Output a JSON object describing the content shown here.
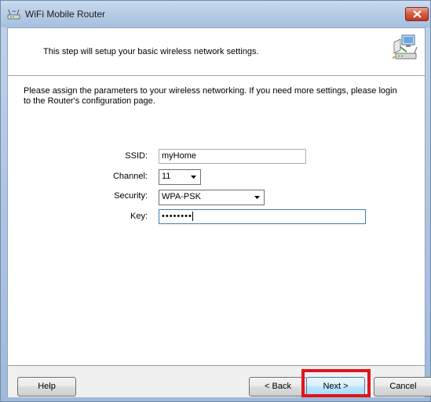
{
  "window": {
    "title": "WiFi Mobile Router"
  },
  "header": {
    "text": "This step will setup your basic wireless network settings."
  },
  "intro": {
    "text": "Please assign the parameters to your wireless networking. If you need more settings, please login to the Router's configuration page."
  },
  "form": {
    "ssid": {
      "label": "SSID:",
      "value": "myHome"
    },
    "channel": {
      "label": "Channel:",
      "value": "11"
    },
    "security": {
      "label": "Security:",
      "value": "WPA-PSK"
    },
    "key": {
      "label": "Key:",
      "value": "••••••••"
    }
  },
  "buttons": {
    "help": "Help",
    "back": "< Back",
    "next": "Next >",
    "cancel": "Cancel"
  },
  "icons": {
    "app": "router-icon",
    "wizard": "network-wizard-icon",
    "close": "close-icon"
  },
  "colors": {
    "highlight": "#e0141e"
  }
}
